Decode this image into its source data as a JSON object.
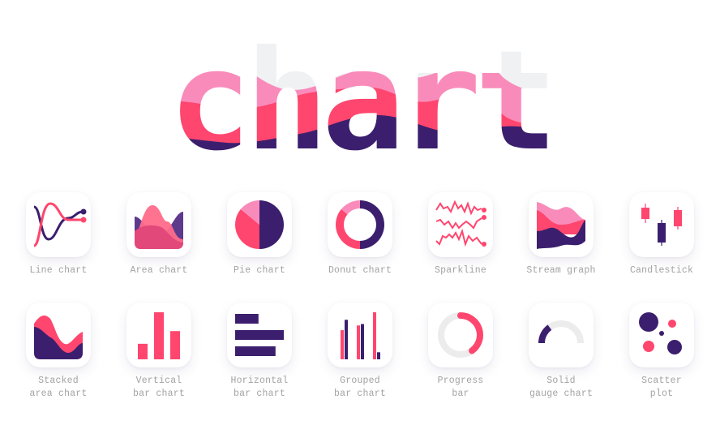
{
  "title": "chart",
  "colors": {
    "dark": "#3b1f6e",
    "red": "#ff466e",
    "pink": "#f98bbb",
    "gray": "#f0f1f3",
    "track": "#ececec",
    "label": "#a3a3a3"
  },
  "icons": [
    {
      "id": "line-chart",
      "label_lines": [
        "Line chart"
      ]
    },
    {
      "id": "area-chart",
      "label_lines": [
        "Area chart"
      ]
    },
    {
      "id": "pie-chart",
      "label_lines": [
        "Pie chart"
      ]
    },
    {
      "id": "donut-chart",
      "label_lines": [
        "Donut chart"
      ]
    },
    {
      "id": "sparkline",
      "label_lines": [
        "Sparkline"
      ]
    },
    {
      "id": "stream-graph",
      "label_lines": [
        "Stream graph"
      ]
    },
    {
      "id": "candlestick",
      "label_lines": [
        "Candlestick"
      ]
    },
    {
      "id": "stacked-area-chart",
      "label_lines": [
        "Stacked",
        "area chart"
      ]
    },
    {
      "id": "vertical-bar-chart",
      "label_lines": [
        "Vertical",
        "bar chart"
      ]
    },
    {
      "id": "horizontal-bar-chart",
      "label_lines": [
        "Horizontal",
        "bar chart"
      ]
    },
    {
      "id": "grouped-bar-chart",
      "label_lines": [
        "Grouped",
        "bar chart"
      ]
    },
    {
      "id": "progress-bar",
      "label_lines": [
        "Progress",
        "bar"
      ]
    },
    {
      "id": "solid-gauge-chart",
      "label_lines": [
        "Solid",
        "gauge chart"
      ]
    },
    {
      "id": "scatter-plot",
      "label_lines": [
        "Scatter",
        "plot"
      ]
    }
  ],
  "icon_values": {
    "pie": [
      0.5,
      0.36,
      0.14
    ],
    "donut": [
      0.5,
      0.36,
      0.14
    ],
    "vertical_bars": [
      0.33,
      1.0,
      0.6
    ],
    "horizontal_bars": [
      0.48,
      1.0,
      0.83
    ],
    "grouped_bars": [
      [
        0.62,
        0.84
      ],
      [
        0.72,
        0.75
      ],
      [
        1.0,
        0.15
      ]
    ],
    "progress": 0.4,
    "gauge": 0.3
  }
}
